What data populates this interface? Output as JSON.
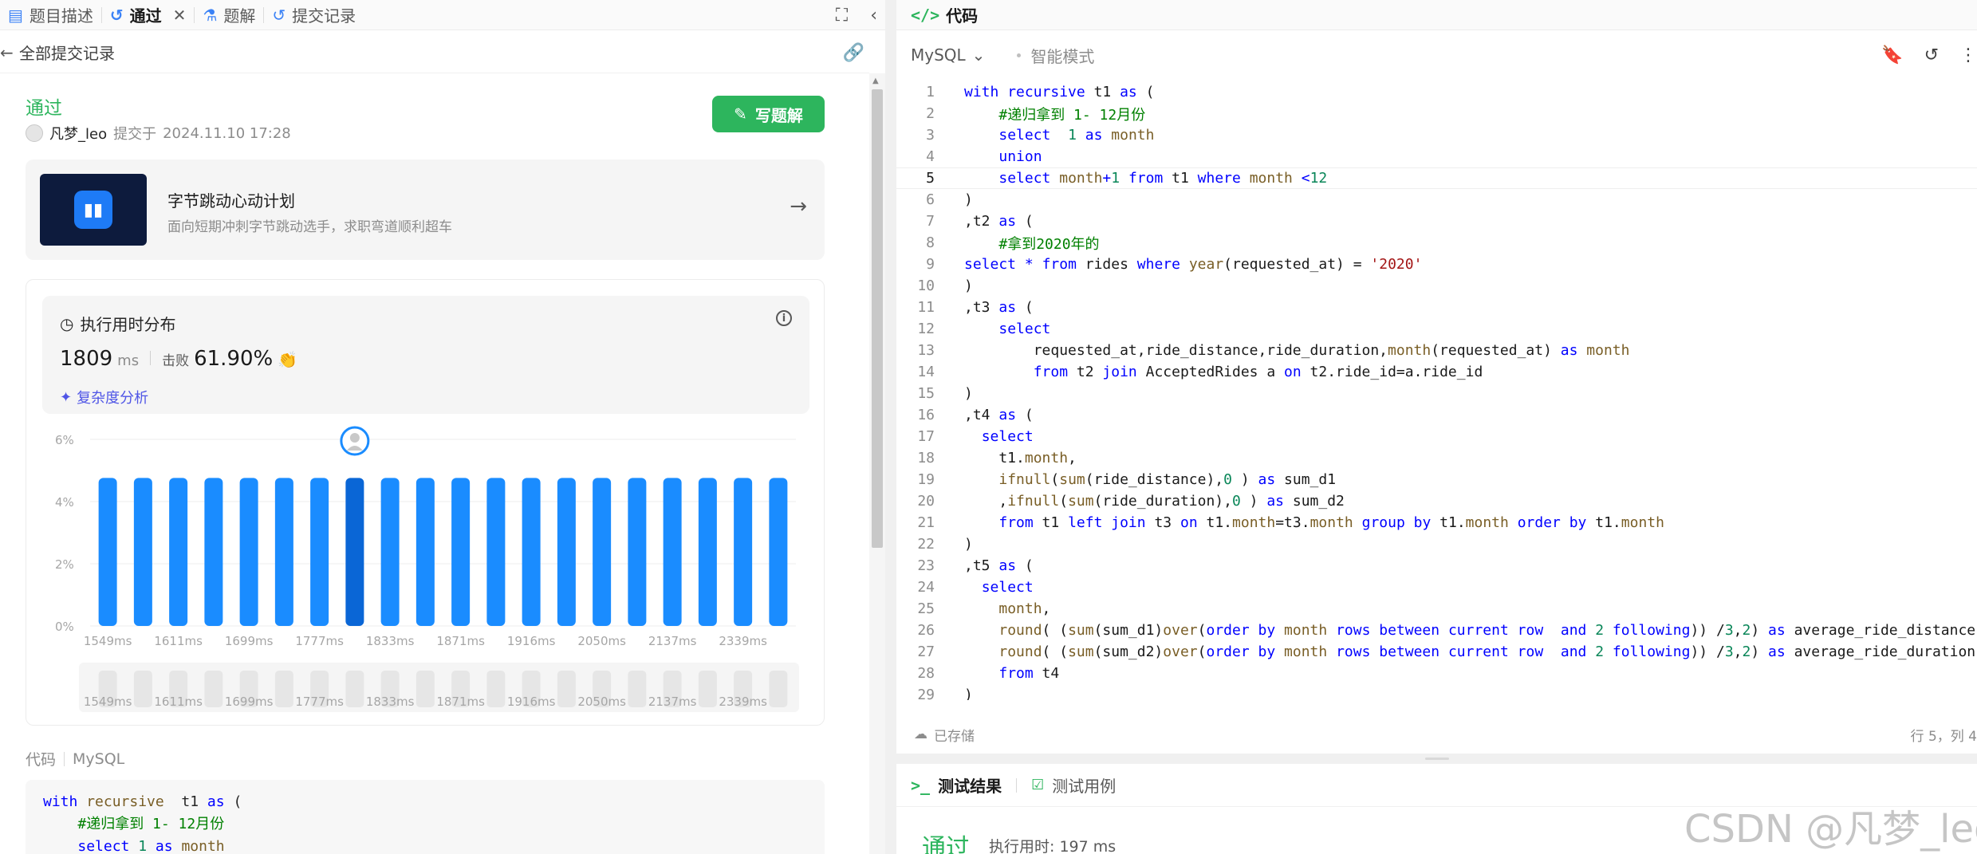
{
  "tabs": [
    {
      "label": "题目描述",
      "icon": "document-icon"
    },
    {
      "label": "通过",
      "icon": "history-icon",
      "active": true
    },
    {
      "label": "题解",
      "icon": "flask-icon"
    },
    {
      "label": "提交记录",
      "icon": "history-icon"
    }
  ],
  "subbar": {
    "label": "全部提交记录"
  },
  "submission": {
    "status": "通过",
    "user": "凡梦_leo",
    "submitted_prefix": "提交于",
    "submitted_at": "2024.11.10 17:28",
    "write_button": "写题解"
  },
  "promo": {
    "title": "字节跳动心动计划",
    "subtitle": "面向短期冲刺字节跳动选手，求职弯道顺利超车"
  },
  "perf": {
    "title": "执行用时分布",
    "value": "1809",
    "unit": "ms",
    "beat_label": "击败",
    "beat_pct": "61.90%",
    "analysis_link": "复杂度分析"
  },
  "chart_data": {
    "type": "bar",
    "ylim": [
      0,
      6
    ],
    "yticks": [
      "0%",
      "2%",
      "4%",
      "6%"
    ],
    "xtick_labels": [
      "1549ms",
      "1611ms",
      "1699ms",
      "1777ms",
      "1833ms",
      "1871ms",
      "1916ms",
      "2050ms",
      "2137ms",
      "2339ms"
    ],
    "values": [
      4.76,
      4.76,
      4.76,
      4.76,
      4.76,
      4.76,
      4.76,
      4.76,
      4.76,
      4.76,
      4.76,
      4.76,
      4.76,
      4.76,
      4.76,
      4.76,
      4.76,
      4.76,
      4.76,
      4.76
    ],
    "highlight_index": 7,
    "bar_color": "#1a8cff",
    "highlight_color": "#0a66d6"
  },
  "code_section": {
    "label": "代码",
    "lang": "MySQL"
  },
  "preview_code": [
    [
      [
        "k",
        "with "
      ],
      [
        "f",
        "recursive"
      ],
      [
        "",
        "  t1 "
      ],
      [
        "k",
        "as"
      ],
      [
        "",
        " ("
      ]
    ],
    [
      [
        "",
        "    "
      ],
      [
        "c",
        "#递归拿到 1- 12月份"
      ]
    ],
    [
      [
        "",
        "    "
      ],
      [
        "k",
        "select"
      ],
      [
        "",
        " "
      ],
      [
        "n",
        "1"
      ],
      [
        "",
        " "
      ],
      [
        "k",
        "as"
      ],
      [
        "",
        " "
      ],
      [
        "f",
        "month"
      ]
    ]
  ],
  "editor": {
    "title": "代码",
    "language": "MySQL",
    "mode": "智能模式",
    "saved_status": "已存储",
    "cursor_pos": "行 5，列 4",
    "current_line": 5,
    "lines": [
      [
        [
          "k",
          "with "
        ],
        [
          "k",
          "recursive"
        ],
        [
          "",
          " t1 "
        ],
        [
          "k",
          "as"
        ],
        [
          "",
          " ("
        ]
      ],
      [
        [
          "",
          "    "
        ],
        [
          "c",
          "#递归拿到 1- 12月份"
        ]
      ],
      [
        [
          "",
          "    "
        ],
        [
          "k",
          "select"
        ],
        [
          "",
          "  "
        ],
        [
          "n",
          "1"
        ],
        [
          "",
          " "
        ],
        [
          "k",
          "as"
        ],
        [
          "",
          " "
        ],
        [
          "f",
          "month"
        ]
      ],
      [
        [
          "",
          "    "
        ],
        [
          "k",
          "union"
        ]
      ],
      [
        [
          "",
          "    "
        ],
        [
          "k",
          "select"
        ],
        [
          "",
          " "
        ],
        [
          "f",
          "month"
        ],
        [
          "k",
          "+"
        ],
        [
          "n",
          "1"
        ],
        [
          "",
          " "
        ],
        [
          "k",
          "from"
        ],
        [
          "",
          " t1 "
        ],
        [
          "k",
          "where"
        ],
        [
          "",
          " "
        ],
        [
          "f",
          "month"
        ],
        [
          "",
          " "
        ],
        [
          "k",
          "<"
        ],
        [
          "n",
          "12"
        ]
      ],
      [
        [
          "",
          ")"
        ]
      ],
      [
        [
          "",
          ",t2 "
        ],
        [
          "k",
          "as"
        ],
        [
          "",
          " ("
        ]
      ],
      [
        [
          "",
          "    "
        ],
        [
          "c",
          "#拿到2020年的"
        ]
      ],
      [
        [
          "k",
          "select"
        ],
        [
          "",
          " "
        ],
        [
          "k",
          "*"
        ],
        [
          "",
          " "
        ],
        [
          "k",
          "from"
        ],
        [
          "",
          " rides "
        ],
        [
          "k",
          "where"
        ],
        [
          "",
          " "
        ],
        [
          "f",
          "year"
        ],
        [
          "",
          "(requested_at) = "
        ],
        [
          "s",
          "'2020'"
        ]
      ],
      [
        [
          "",
          ")"
        ]
      ],
      [
        [
          "",
          ",t3 "
        ],
        [
          "k",
          "as"
        ],
        [
          "",
          " ("
        ]
      ],
      [
        [
          "",
          "    "
        ],
        [
          "k",
          "select"
        ]
      ],
      [
        [
          "",
          "        requested_at,ride_distance,ride_duration,"
        ],
        [
          "f",
          "month"
        ],
        [
          "",
          "(requested_at) "
        ],
        [
          "k",
          "as"
        ],
        [
          "",
          " "
        ],
        [
          "f",
          "month"
        ]
      ],
      [
        [
          "",
          "        "
        ],
        [
          "k",
          "from"
        ],
        [
          "",
          " t2 "
        ],
        [
          "k",
          "join"
        ],
        [
          "",
          " AcceptedRides a "
        ],
        [
          "k",
          "on"
        ],
        [
          "",
          " t2.ride_id=a.ride_id"
        ]
      ],
      [
        [
          "",
          ")"
        ]
      ],
      [
        [
          "",
          ",t4 "
        ],
        [
          "k",
          "as"
        ],
        [
          "",
          " ("
        ]
      ],
      [
        [
          "",
          "  "
        ],
        [
          "k",
          "select"
        ]
      ],
      [
        [
          "",
          "    t1."
        ],
        [
          "f",
          "month"
        ],
        [
          "",
          ","
        ]
      ],
      [
        [
          "",
          "    "
        ],
        [
          "f",
          "ifnull"
        ],
        [
          "",
          "("
        ],
        [
          "f",
          "sum"
        ],
        [
          "",
          "(ride_distance),"
        ],
        [
          "n",
          "0"
        ],
        [
          "",
          " ) "
        ],
        [
          "k",
          "as"
        ],
        [
          "",
          " sum_d1"
        ]
      ],
      [
        [
          "",
          "    ,"
        ],
        [
          "f",
          "ifnull"
        ],
        [
          "",
          "("
        ],
        [
          "f",
          "sum"
        ],
        [
          "",
          "(ride_duration),"
        ],
        [
          "n",
          "0"
        ],
        [
          "",
          " ) "
        ],
        [
          "k",
          "as"
        ],
        [
          "",
          " sum_d2"
        ]
      ],
      [
        [
          "",
          "    "
        ],
        [
          "k",
          "from"
        ],
        [
          "",
          " t1 "
        ],
        [
          "k",
          "left join"
        ],
        [
          "",
          " t3 "
        ],
        [
          "k",
          "on"
        ],
        [
          "",
          " t1."
        ],
        [
          "f",
          "month"
        ],
        [
          "",
          "=t3."
        ],
        [
          "f",
          "month"
        ],
        [
          "",
          " "
        ],
        [
          "k",
          "group by"
        ],
        [
          "",
          " t1."
        ],
        [
          "f",
          "month"
        ],
        [
          "",
          " "
        ],
        [
          "k",
          "order by"
        ],
        [
          "",
          " t1."
        ],
        [
          "f",
          "month"
        ]
      ],
      [
        [
          "",
          ")"
        ]
      ],
      [
        [
          "",
          ",t5 "
        ],
        [
          "k",
          "as"
        ],
        [
          "",
          " ("
        ]
      ],
      [
        [
          "",
          "  "
        ],
        [
          "k",
          "select"
        ]
      ],
      [
        [
          "",
          "    "
        ],
        [
          "f",
          "month"
        ],
        [
          "",
          ","
        ]
      ],
      [
        [
          "",
          "    "
        ],
        [
          "f",
          "round"
        ],
        [
          "",
          "( ("
        ],
        [
          "f",
          "sum"
        ],
        [
          "",
          "(sum_d1)"
        ],
        [
          "f",
          "over"
        ],
        [
          "",
          "("
        ],
        [
          "k",
          "order by"
        ],
        [
          "",
          " "
        ],
        [
          "f",
          "month"
        ],
        [
          "",
          " "
        ],
        [
          "k",
          "rows between"
        ],
        [
          "",
          " "
        ],
        [
          "k",
          "current"
        ],
        [
          "",
          " "
        ],
        [
          "k",
          "row"
        ],
        [
          "",
          "  "
        ],
        [
          "k",
          "and"
        ],
        [
          "",
          " "
        ],
        [
          "n",
          "2"
        ],
        [
          "",
          " "
        ],
        [
          "k",
          "following"
        ],
        [
          "",
          "))"
        ],
        [
          "",
          " /"
        ],
        [
          "n",
          "3"
        ],
        [
          "",
          ","
        ],
        [
          "n",
          "2"
        ],
        [
          "",
          ") "
        ],
        [
          "k",
          "as"
        ],
        [
          "",
          " average_ride_distance,"
        ]
      ],
      [
        [
          "",
          "    "
        ],
        [
          "f",
          "round"
        ],
        [
          "",
          "( ("
        ],
        [
          "f",
          "sum"
        ],
        [
          "",
          "(sum_d2)"
        ],
        [
          "f",
          "over"
        ],
        [
          "",
          "("
        ],
        [
          "k",
          "order by"
        ],
        [
          "",
          " "
        ],
        [
          "f",
          "month"
        ],
        [
          "",
          " "
        ],
        [
          "k",
          "rows between"
        ],
        [
          "",
          " "
        ],
        [
          "k",
          "current"
        ],
        [
          "",
          " "
        ],
        [
          "k",
          "row"
        ],
        [
          "",
          "  "
        ],
        [
          "k",
          "and"
        ],
        [
          "",
          " "
        ],
        [
          "n",
          "2"
        ],
        [
          "",
          " "
        ],
        [
          "k",
          "following"
        ],
        [
          "",
          "))"
        ],
        [
          "",
          " /"
        ],
        [
          "n",
          "3"
        ],
        [
          "",
          ","
        ],
        [
          "n",
          "2"
        ],
        [
          "",
          ") "
        ],
        [
          "k",
          "as"
        ],
        [
          "",
          " average_ride_duration"
        ]
      ],
      [
        [
          "",
          "    "
        ],
        [
          "k",
          "from"
        ],
        [
          "",
          " t4"
        ]
      ],
      [
        [
          "",
          ")"
        ]
      ]
    ]
  },
  "results": {
    "tab_result": "测试结果",
    "tab_cases": "测试用例",
    "status": "通过",
    "runtime": "执行用时: 197 ms"
  },
  "watermark": "CSDN @凡梦_leo"
}
